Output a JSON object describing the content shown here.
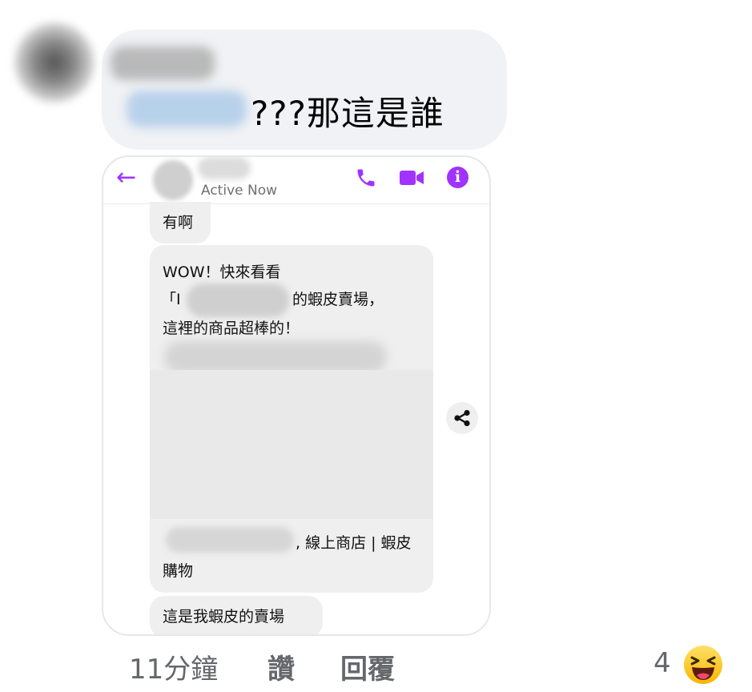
{
  "comment": {
    "text": "???那這是誰"
  },
  "messenger": {
    "status": "Active Now",
    "messages": [
      "有啊",
      "WOW！快來看看",
      "「I",
      "的蝦皮賣場，",
      "這裡的商品超棒的！",
      "這是我蝦皮的賣場"
    ],
    "preview": {
      "title_suffix": ", 線上商店 | 蝦皮",
      "subtitle": "購物"
    },
    "accent_color": "#a033ff"
  },
  "actions": {
    "time": "11分鐘",
    "like": "讚",
    "reply": "回覆",
    "reaction_count": "4",
    "reaction_icon": "haha-emoji"
  }
}
